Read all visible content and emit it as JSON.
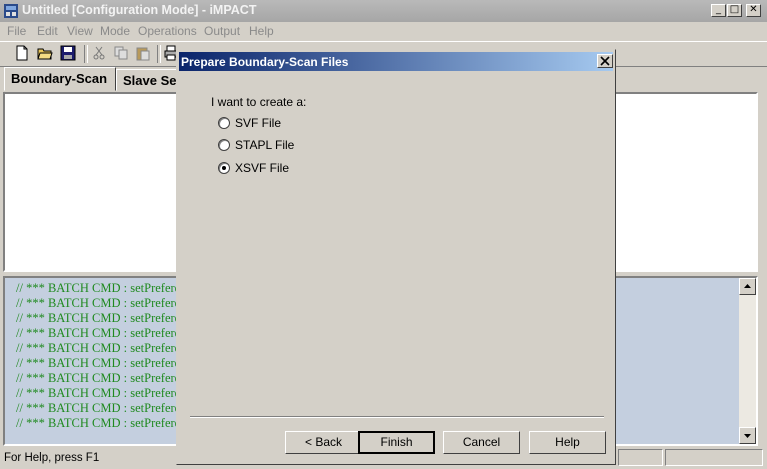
{
  "window": {
    "title": "Untitled [Configuration Mode] - iMPACT",
    "controls": {
      "minimize": "_",
      "maximize": "□",
      "close": "✕"
    }
  },
  "menu": [
    "File",
    "Edit",
    "View",
    "Mode",
    "Operations",
    "Output",
    "Help"
  ],
  "tabs": [
    "Boundary-Scan",
    "Slave Serial"
  ],
  "console": {
    "lines": [
      "// *** BATCH CMD : setPreferen",
      "// *** BATCH CMD : setPreferen",
      "// *** BATCH CMD : setPreferen",
      "// *** BATCH CMD : setPreferen",
      "// *** BATCH CMD : setPreferen",
      "// *** BATCH CMD : setPreferen",
      "// *** BATCH CMD : setPreferen",
      "// *** BATCH CMD : setPreferen",
      "// *** BATCH CMD : setPreferen",
      "// *** BATCH CMD : setPreferen"
    ]
  },
  "status": {
    "text": "For Help, press F1"
  },
  "dialog": {
    "title": "Prepare Boundary-Scan Files",
    "prompt": "I want to create a:",
    "options": [
      {
        "label": "SVF File",
        "selected": false
      },
      {
        "label": "STAPL File",
        "selected": false
      },
      {
        "label": "XSVF File",
        "selected": true
      }
    ],
    "buttons": {
      "back": "< Back",
      "finish": "Finish",
      "cancel": "Cancel",
      "help": "Help"
    }
  }
}
